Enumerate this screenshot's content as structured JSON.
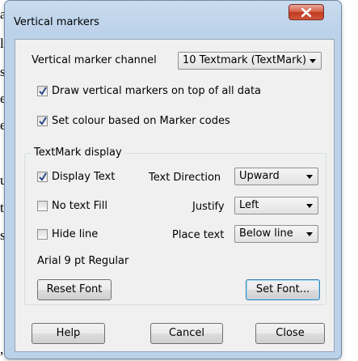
{
  "background_chars": [
    "a",
    "l",
    "s",
    "e",
    "e",
    "u",
    "t",
    "s",
    ","
  ],
  "window": {
    "title": "Vertical markers",
    "close_icon": "x-icon"
  },
  "channel": {
    "label": "Vertical marker channel",
    "value": "10 Textmark (TextMark)"
  },
  "options": {
    "draw_on_top": {
      "label": "Draw vertical markers on top of all data",
      "checked": true
    },
    "set_colour": {
      "label": "Set colour based on Marker codes",
      "checked": true
    }
  },
  "textmark_display": {
    "group_title": "TextMark display",
    "display_text": {
      "label": "Display Text",
      "checked": true
    },
    "no_text_fill": {
      "label": "No text Fill",
      "checked": false
    },
    "hide_line": {
      "label": "Hide line",
      "checked": false
    },
    "text_direction": {
      "label": "Text Direction",
      "value": "Upward"
    },
    "justify": {
      "label": "Justify",
      "value": "Left"
    },
    "place_text": {
      "label": "Place text",
      "value": "Below line"
    },
    "font_desc": "Arial 9 pt  Regular",
    "reset_font": "Reset Font",
    "set_font": "Set Font..."
  },
  "footer": {
    "help": "Help",
    "cancel": "Cancel",
    "close": "Close"
  }
}
